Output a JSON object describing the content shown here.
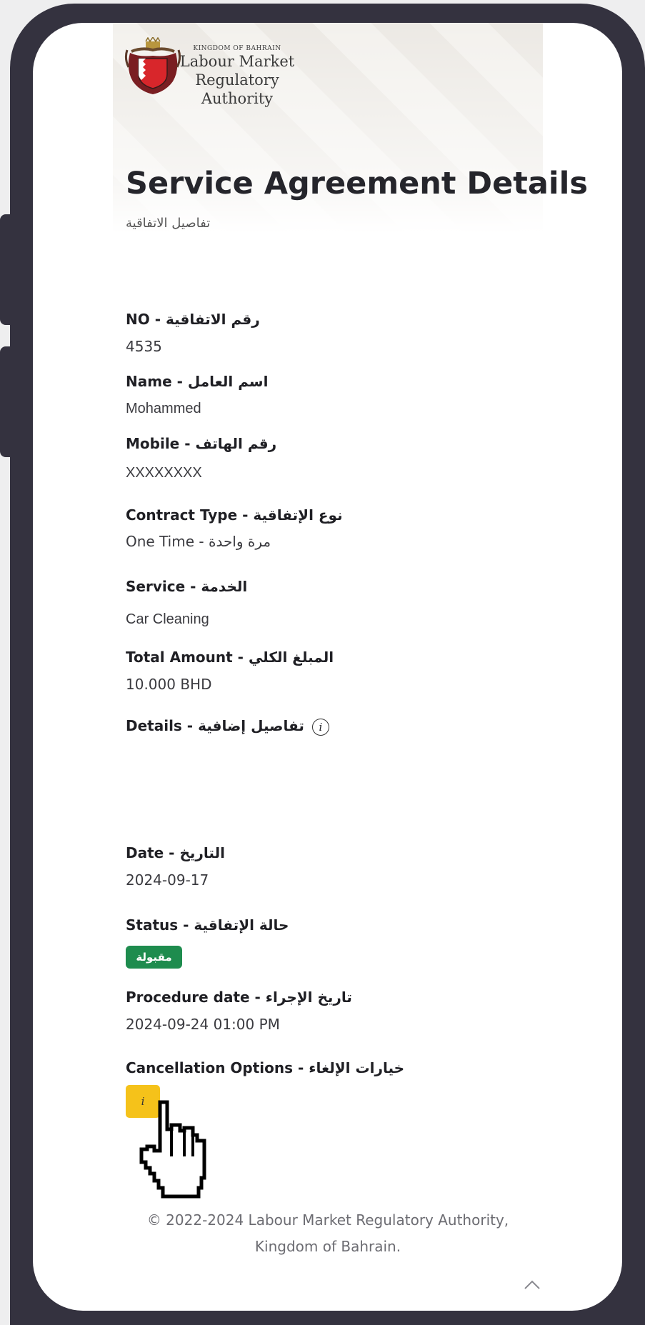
{
  "header": {
    "org_kingdom": "KINGDOM OF BAHRAIN",
    "org_name_line1": "Labour Market",
    "org_name_line2": "Regulatory Authority",
    "title": "Service Agreement Details",
    "subtitle": "تفاصيل الاتفاقية"
  },
  "fields": {
    "no_label": "NO - رقم الاتفاقية",
    "no_value": "4535",
    "name_label": "Name - اسم العامل",
    "name_value": "Mohammed",
    "mobile_label": "Mobile - رقم الهاتف",
    "mobile_value": "XXXXXXXX",
    "contract_label": "Contract Type - نوع الإتفاقية",
    "contract_value": "One Time - مرة واحدة",
    "service_label": "Service - الخدمة",
    "service_value": "Car Cleaning",
    "amount_label": "Total Amount - المبلغ الكلي",
    "amount_value": "10.000 BHD",
    "details_label": "Details - تفاصيل إضافية",
    "details_info_icon": "i",
    "date_label": "Date - التاريخ",
    "date_value": "2024-09-17",
    "status_label": "Status - حالة الإتفاقية",
    "status_badge": "مقبولة",
    "procedure_label": "Procedure date - تاريخ الإجراء",
    "procedure_value": "2024-09-24 01:00 PM",
    "cancel_label": "Cancellation Options - خيارات الإلغاء",
    "cancel_button_icon": "i"
  },
  "footer": {
    "line1": "© 2022-2024 Labour Market Regulatory Authority,",
    "line2": "Kingdom of Bahrain."
  },
  "colors": {
    "phone_frame": "#34323f",
    "status_badge": "#1e8c4e",
    "cancel_button": "#f5c21a"
  },
  "icons": {
    "logo": "bahrain-coat-of-arms-icon",
    "details_info": "info-circle-icon",
    "cursor": "hand-pointer-cursor-icon",
    "scroll_top": "chevron-up-icon"
  }
}
